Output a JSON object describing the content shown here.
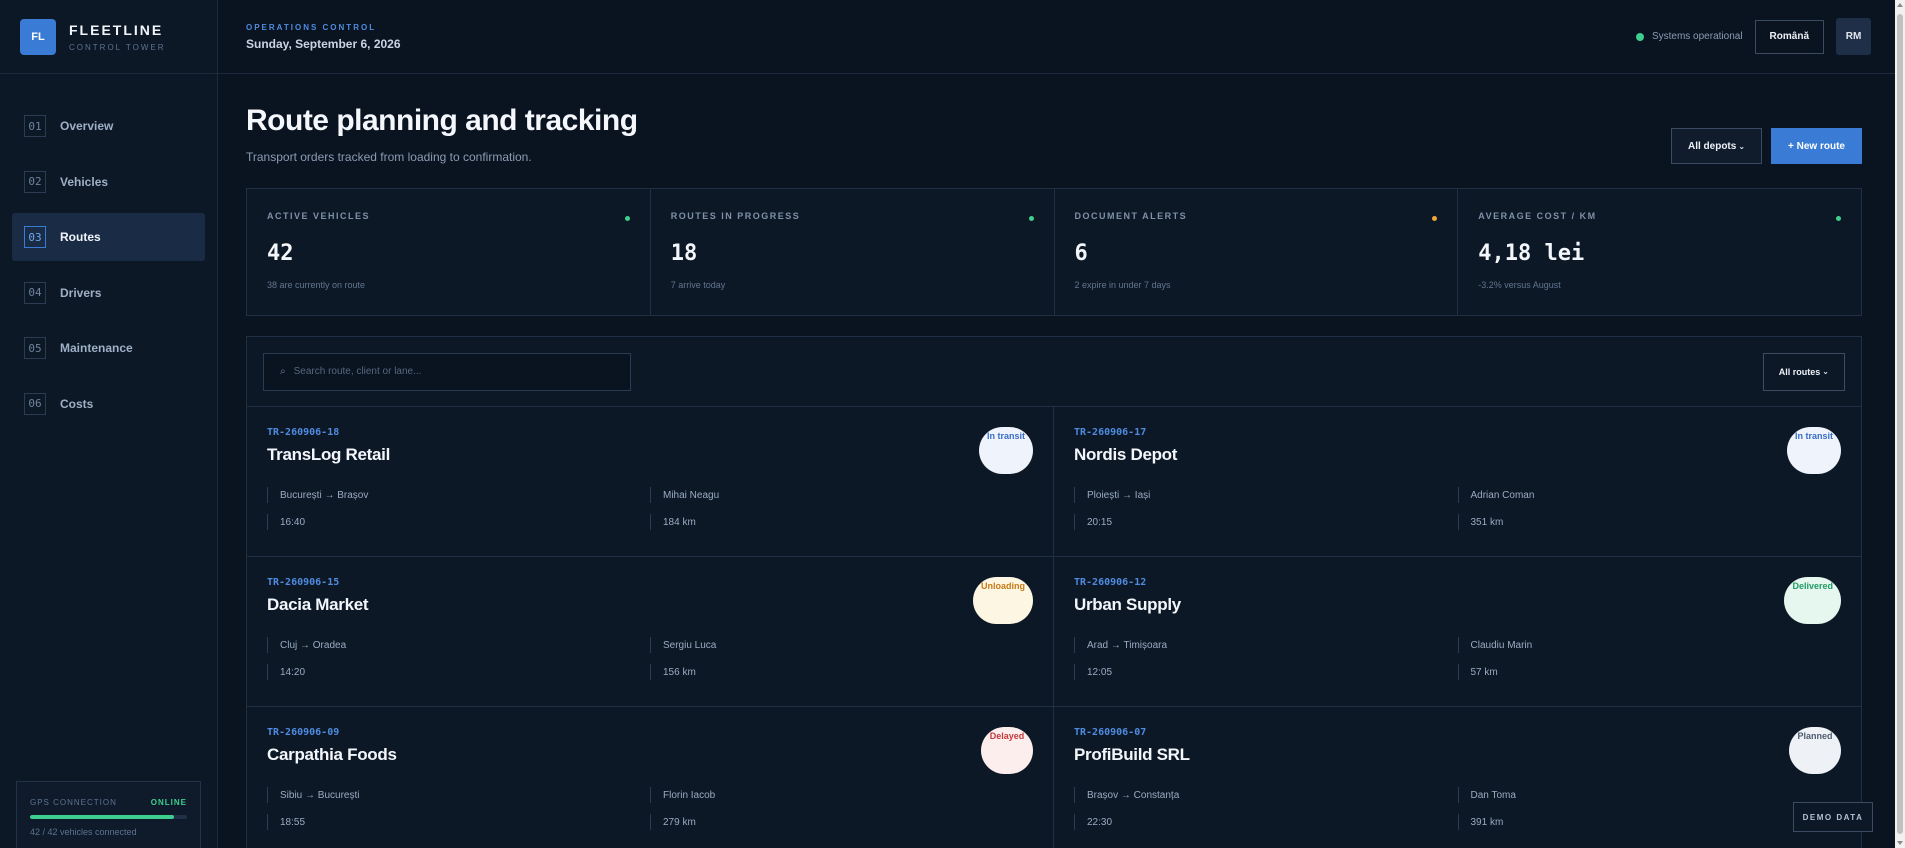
{
  "brand": {
    "logo": "FL",
    "name": "FLEETLINE",
    "subtitle": "CONTROL TOWER"
  },
  "sidebar": {
    "items": [
      {
        "num": "01",
        "label": "Overview",
        "active": false
      },
      {
        "num": "02",
        "label": "Vehicles",
        "active": false
      },
      {
        "num": "03",
        "label": "Routes",
        "active": true
      },
      {
        "num": "04",
        "label": "Drivers",
        "active": false
      },
      {
        "num": "05",
        "label": "Maintenance",
        "active": false
      },
      {
        "num": "06",
        "label": "Costs",
        "active": false
      }
    ],
    "gps": {
      "title": "GPS CONNECTION",
      "status": "ONLINE",
      "connected_fraction": 0.92,
      "count_text": "42 / 42 vehicles connected"
    }
  },
  "topbar": {
    "eyebrow": "OPERATIONS CONTROL",
    "date": "Sunday, September 6, 2026",
    "status_text": "Systems operational",
    "language": "Română",
    "avatar": "RM"
  },
  "page": {
    "title": "Route planning and tracking",
    "subtitle": "Transport orders tracked from loading to confirmation.",
    "depot_filter": "All depots",
    "new_route": "+ New route"
  },
  "stats": [
    {
      "label": "ACTIVE VEHICLES",
      "value": "42",
      "note": "38 are currently on route",
      "dot_color": "#3ecf8e"
    },
    {
      "label": "ROUTES IN PROGRESS",
      "value": "18",
      "note": "7 arrive today",
      "dot_color": "#3ecf8e"
    },
    {
      "label": "DOCUMENT ALERTS",
      "value": "6",
      "note": "2 expire in under 7 days",
      "dot_color": "#f0a53a"
    },
    {
      "label": "AVERAGE COST / KM",
      "value": "4,18 lei",
      "note": "-3.2% versus August",
      "dot_color": "#3ecf8e"
    }
  ],
  "routes": {
    "search_placeholder": "Search route, client or lane...",
    "filter": "All routes",
    "cards": [
      {
        "id": "TR-260906-18",
        "client": "TransLog Retail",
        "status": "In transit",
        "status_kind": "transit",
        "lane": "București → Brașov",
        "driver": "Mihai Neagu",
        "time": "16:40",
        "distance": "184 km"
      },
      {
        "id": "TR-260906-17",
        "client": "Nordis Depot",
        "status": "In transit",
        "status_kind": "transit",
        "lane": "Ploiești → Iași",
        "driver": "Adrian Coman",
        "time": "20:15",
        "distance": "351 km"
      },
      {
        "id": "TR-260906-15",
        "client": "Dacia Market",
        "status": "Unloading",
        "status_kind": "unloading",
        "lane": "Cluj → Oradea",
        "driver": "Sergiu Luca",
        "time": "14:20",
        "distance": "156 km"
      },
      {
        "id": "TR-260906-12",
        "client": "Urban Supply",
        "status": "Delivered",
        "status_kind": "delivered",
        "lane": "Arad → Timișoara",
        "driver": "Claudiu Marin",
        "time": "12:05",
        "distance": "57 km"
      },
      {
        "id": "TR-260906-09",
        "client": "Carpathia Foods",
        "status": "Delayed",
        "status_kind": "delayed",
        "lane": "Sibiu → București",
        "driver": "Florin Iacob",
        "time": "18:55",
        "distance": "279 km"
      },
      {
        "id": "TR-260906-07",
        "client": "ProfiBuild SRL",
        "status": "Planned",
        "status_kind": "planned",
        "lane": "Brașov → Constanța",
        "driver": "Dan Toma",
        "time": "22:30",
        "distance": "391 km"
      }
    ]
  },
  "demo_label": "DEMO DATA"
}
